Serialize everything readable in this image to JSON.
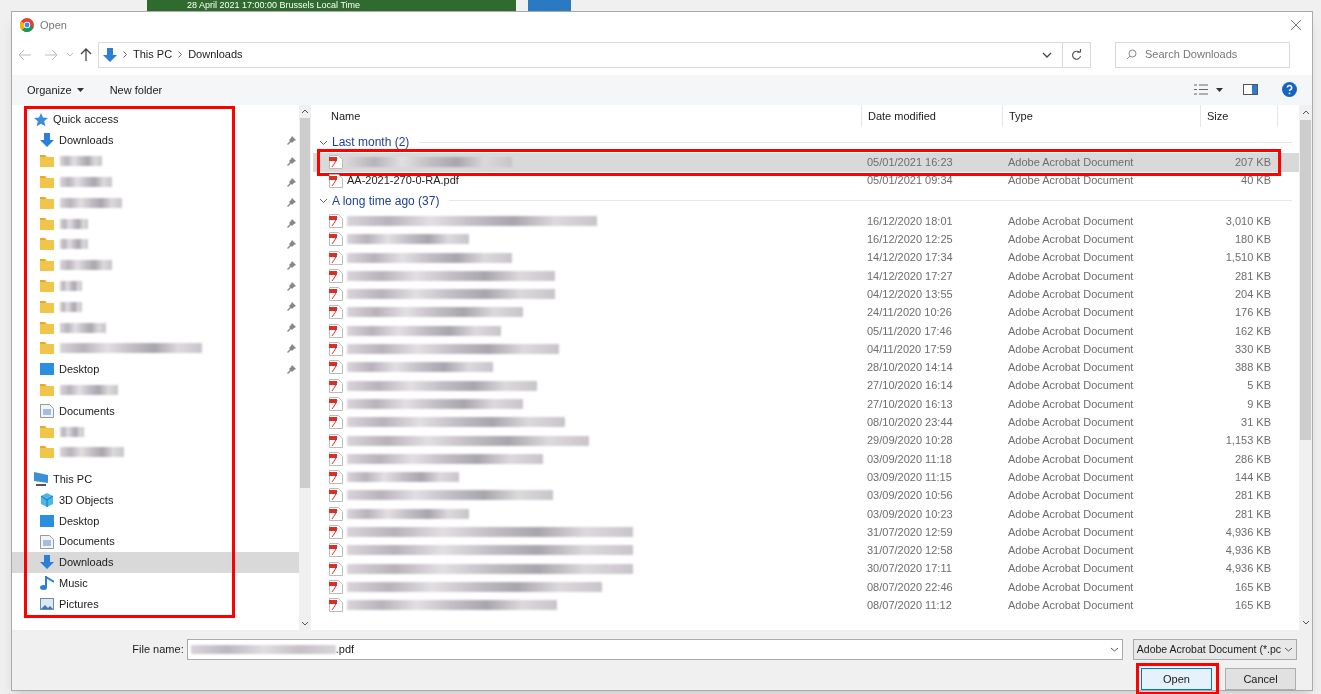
{
  "background": {
    "banner": "28 April 2021 17:00:00 Brussels Local Time"
  },
  "window": {
    "title": "Open"
  },
  "address": {
    "path": [
      "This PC",
      "Downloads"
    ],
    "search_placeholder": "Search Downloads"
  },
  "toolbar": {
    "organize": "Organize",
    "new_folder": "New folder"
  },
  "sidebar": {
    "highlighted": true,
    "items": [
      {
        "kind": "star",
        "label": "Quick access",
        "header": true,
        "pinned": false,
        "selected": false
      },
      {
        "kind": "downloads",
        "label": "Downloads",
        "header": false,
        "pinned": true,
        "selected": false
      },
      {
        "kind": "folder",
        "header": false,
        "pinned": true,
        "selected": false
      },
      {
        "kind": "folder",
        "header": false,
        "pinned": true,
        "selected": false
      },
      {
        "kind": "folder",
        "header": false,
        "pinned": true,
        "selected": false
      },
      {
        "kind": "folder",
        "header": false,
        "pinned": true,
        "selected": false
      },
      {
        "kind": "folder",
        "header": false,
        "pinned": true,
        "selected": false
      },
      {
        "kind": "folder",
        "header": false,
        "pinned": true,
        "selected": false
      },
      {
        "kind": "folder",
        "header": false,
        "pinned": true,
        "selected": false
      },
      {
        "kind": "folder",
        "header": false,
        "pinned": true,
        "selected": false
      },
      {
        "kind": "folder",
        "header": false,
        "pinned": true,
        "selected": false
      },
      {
        "kind": "folder",
        "header": false,
        "pinned": true,
        "selected": false
      },
      {
        "kind": "desktop",
        "label": "Desktop",
        "header": false,
        "pinned": true,
        "selected": false
      },
      {
        "kind": "folder",
        "header": false,
        "pinned": false,
        "selected": false
      },
      {
        "kind": "documents",
        "label": "Documents",
        "header": false,
        "pinned": false,
        "selected": false
      },
      {
        "kind": "folder",
        "header": false,
        "pinned": false,
        "selected": false
      },
      {
        "kind": "folder",
        "header": false,
        "pinned": false,
        "selected": false
      },
      {
        "kind": "pc",
        "label": "This PC",
        "header": true,
        "pinned": false,
        "selected": false
      },
      {
        "kind": "objects3d",
        "label": "3D Objects",
        "header": false,
        "pinned": false,
        "selected": false
      },
      {
        "kind": "desktop",
        "label": "Desktop",
        "header": false,
        "pinned": false,
        "selected": false
      },
      {
        "kind": "documents",
        "label": "Documents",
        "header": false,
        "pinned": false,
        "selected": false
      },
      {
        "kind": "downloads",
        "label": "Downloads",
        "header": false,
        "pinned": false,
        "selected": true
      },
      {
        "kind": "music",
        "label": "Music",
        "header": false,
        "pinned": false,
        "selected": false
      },
      {
        "kind": "pictures",
        "label": "Pictures",
        "header": false,
        "pinned": false,
        "selected": false
      }
    ]
  },
  "table": {
    "columns": [
      "Name",
      "Date modified",
      "Type",
      "Size"
    ],
    "groups": [
      {
        "title": "Last month (2)",
        "expanded": true,
        "rows": [
          {
            "date": "05/01/2021 16:23",
            "type": "Adobe Acrobat Document",
            "size": "207 KB",
            "selected": true,
            "highlighted": true
          },
          {
            "name": "AA-2021-270-0-RA.pdf",
            "date": "05/01/2021 09:34",
            "type": "Adobe Acrobat Document",
            "size": "40 KB",
            "selected": false,
            "highlighted": false
          }
        ]
      },
      {
        "title": "A long time ago (37)",
        "expanded": true,
        "rows": [
          {
            "date": "16/12/2020 18:01",
            "type": "Adobe Acrobat Document",
            "size": "3,010 KB",
            "selected": false,
            "highlighted": false
          },
          {
            "date": "16/12/2020 12:25",
            "type": "Adobe Acrobat Document",
            "size": "180 KB",
            "selected": false,
            "highlighted": false
          },
          {
            "date": "14/12/2020 17:34",
            "type": "Adobe Acrobat Document",
            "size": "1,510 KB",
            "selected": false,
            "highlighted": false
          },
          {
            "date": "14/12/2020 17:27",
            "type": "Adobe Acrobat Document",
            "size": "281 KB",
            "selected": false,
            "highlighted": false
          },
          {
            "date": "04/12/2020 13:55",
            "type": "Adobe Acrobat Document",
            "size": "204 KB",
            "selected": false,
            "highlighted": false
          },
          {
            "date": "24/11/2020 10:26",
            "type": "Adobe Acrobat Document",
            "size": "176 KB",
            "selected": false,
            "highlighted": false
          },
          {
            "date": "05/11/2020 17:46",
            "type": "Adobe Acrobat Document",
            "size": "162 KB",
            "selected": false,
            "highlighted": false
          },
          {
            "date": "04/11/2020 17:59",
            "type": "Adobe Acrobat Document",
            "size": "330 KB",
            "selected": false,
            "highlighted": false
          },
          {
            "date": "28/10/2020 14:14",
            "type": "Adobe Acrobat Document",
            "size": "388 KB",
            "selected": false,
            "highlighted": false
          },
          {
            "date": "27/10/2020 16:14",
            "type": "Adobe Acrobat Document",
            "size": "5 KB",
            "selected": false,
            "highlighted": false
          },
          {
            "date": "27/10/2020 16:13",
            "type": "Adobe Acrobat Document",
            "size": "9 KB",
            "selected": false,
            "highlighted": false
          },
          {
            "date": "08/10/2020 23:44",
            "type": "Adobe Acrobat Document",
            "size": "31 KB",
            "selected": false,
            "highlighted": false
          },
          {
            "date": "29/09/2020 10:28",
            "type": "Adobe Acrobat Document",
            "size": "1,153 KB",
            "selected": false,
            "highlighted": false
          },
          {
            "date": "03/09/2020 11:18",
            "type": "Adobe Acrobat Document",
            "size": "286 KB",
            "selected": false,
            "highlighted": false
          },
          {
            "date": "03/09/2020 11:15",
            "type": "Adobe Acrobat Document",
            "size": "144 KB",
            "selected": false,
            "highlighted": false
          },
          {
            "date": "03/09/2020 10:56",
            "type": "Adobe Acrobat Document",
            "size": "281 KB",
            "selected": false,
            "highlighted": false
          },
          {
            "date": "03/09/2020 10:23",
            "type": "Adobe Acrobat Document",
            "size": "281 KB",
            "selected": false,
            "highlighted": false
          },
          {
            "date": "31/07/2020 12:59",
            "type": "Adobe Acrobat Document",
            "size": "4,936 KB",
            "selected": false,
            "highlighted": false
          },
          {
            "date": "31/07/2020 12:58",
            "type": "Adobe Acrobat Document",
            "size": "4,936 KB",
            "selected": false,
            "highlighted": false
          },
          {
            "date": "30/07/2020 17:11",
            "type": "Adobe Acrobat Document",
            "size": "4,936 KB",
            "selected": false,
            "highlighted": false
          },
          {
            "date": "08/07/2020 22:46",
            "type": "Adobe Acrobat Document",
            "size": "165 KB",
            "selected": false,
            "highlighted": false
          },
          {
            "date": "08/07/2020 11:12",
            "type": "Adobe Acrobat Document",
            "size": "165 KB",
            "selected": false,
            "highlighted": false
          }
        ]
      }
    ]
  },
  "footer": {
    "file_name_label": "File name:",
    "file_name_suffix": ".pdf",
    "file_type": "Adobe Acrobat Document (*.pc",
    "open": "Open",
    "open_highlighted": true,
    "cancel": "Cancel"
  }
}
